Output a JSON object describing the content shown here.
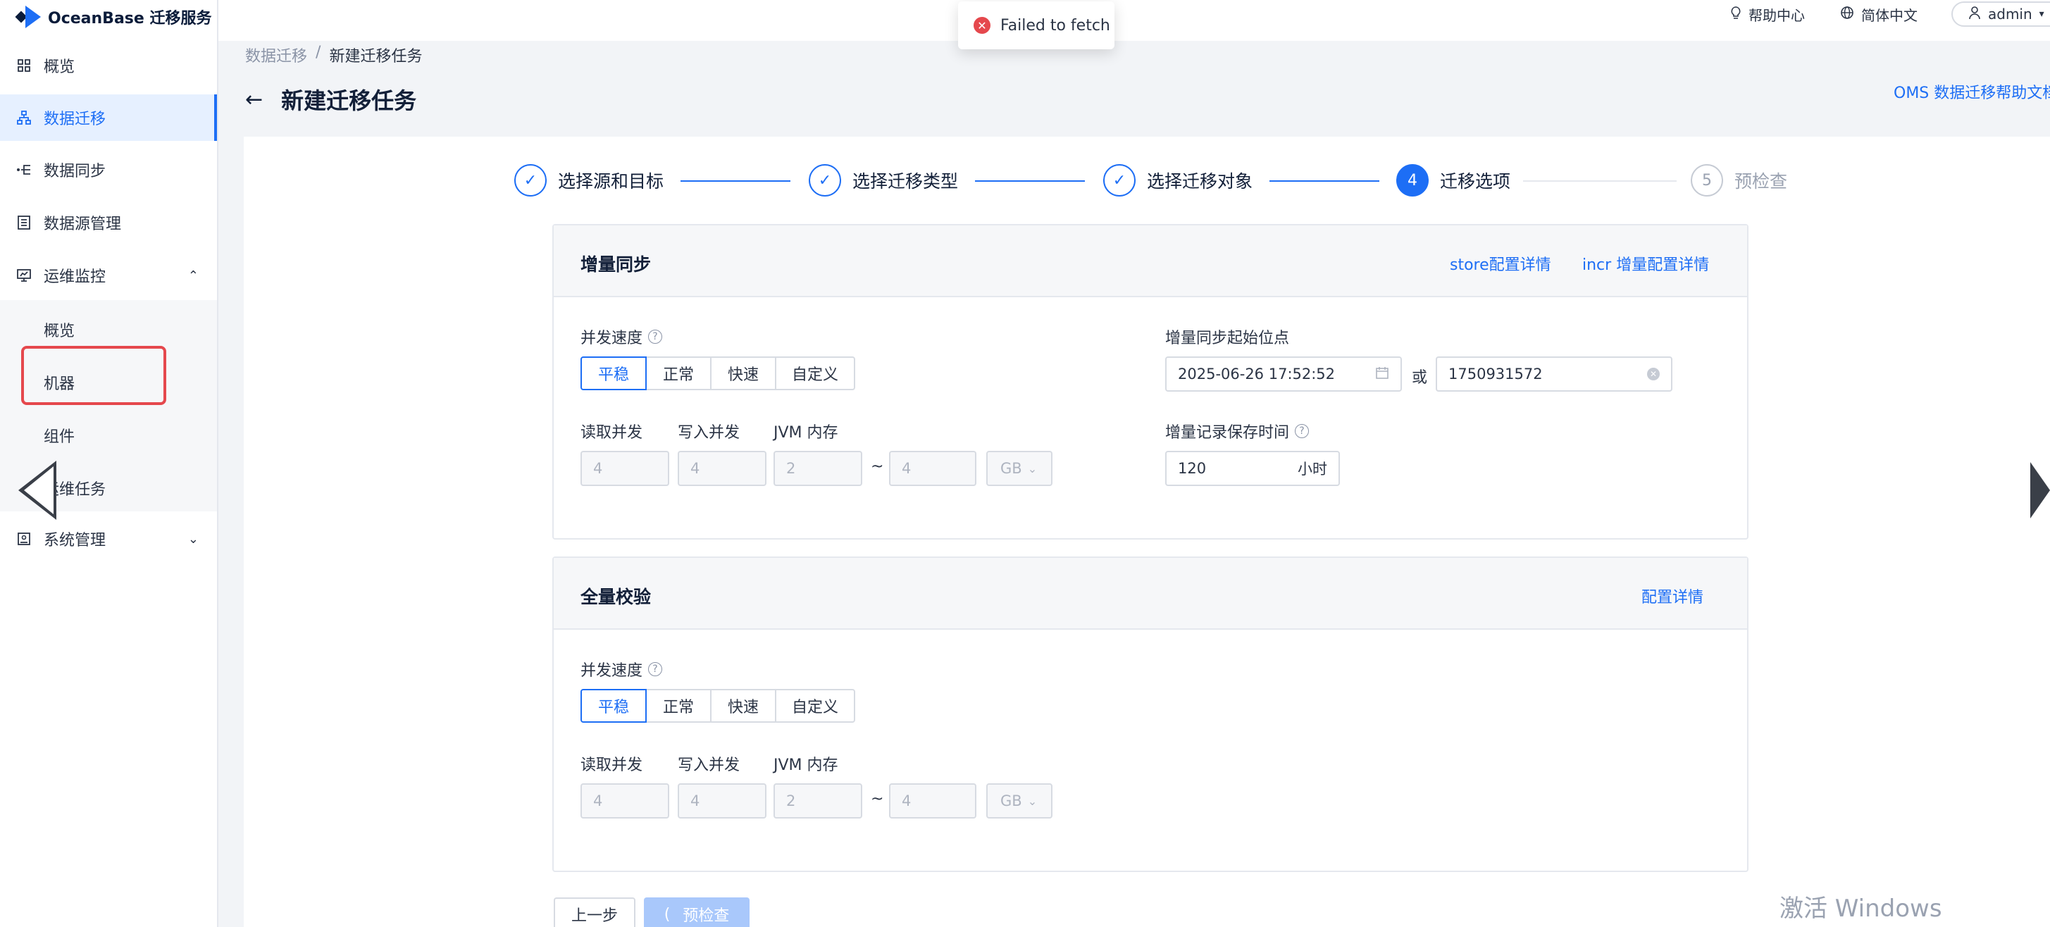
{
  "app": {
    "logo_text": "OceanBase 迁移服务"
  },
  "header": {
    "help": "帮助中心",
    "language": "简体中文",
    "user": "admin"
  },
  "toast": {
    "message": "Failed to fetch"
  },
  "sidebar": {
    "items": [
      {
        "label": "概览",
        "icon": "dashboard-icon"
      },
      {
        "label": "数据迁移",
        "icon": "migration-icon"
      },
      {
        "label": "数据同步",
        "icon": "sync-icon"
      },
      {
        "label": "数据源管理",
        "icon": "datasource-icon"
      },
      {
        "label": "运维监控",
        "icon": "monitor-icon"
      },
      {
        "label": "系统管理",
        "icon": "system-icon"
      }
    ],
    "monitor_sub": [
      "概览",
      "机器",
      "组件",
      "运维任务"
    ]
  },
  "breadcrumb": {
    "parent": "数据迁移",
    "separator": "/",
    "current": "新建迁移任务"
  },
  "page": {
    "title": "新建迁移任务",
    "help_link": "OMS 数据迁移帮助文档"
  },
  "steps": [
    {
      "label": "选择源和目标",
      "status": "done"
    },
    {
      "label": "选择迁移类型",
      "status": "done"
    },
    {
      "label": "选择迁移对象",
      "status": "done"
    },
    {
      "label": "迁移选项",
      "status": "current",
      "index": "4"
    },
    {
      "label": "预检查",
      "status": "wait",
      "index": "5"
    }
  ],
  "incr": {
    "title": "增量同步",
    "link_store": "store配置详情",
    "link_incr": "incr 增量配置详情",
    "concurrency_label": "并发速度",
    "speed_options": [
      "平稳",
      "正常",
      "快速",
      "自定义"
    ],
    "selected_speed": "平稳",
    "read_label": "读取并发",
    "write_label": "写入并发",
    "jvm_label": "JVM 内存",
    "read_value": "4",
    "write_value": "4",
    "jvm_min": "2",
    "jvm_max": "4",
    "jvm_unit": "GB",
    "start_label": "增量同步起始位点",
    "start_datetime": "2025-06-26 17:52:52",
    "or_text": "或",
    "start_timestamp": "1750931572",
    "retention_label": "增量记录保存时间",
    "retention_value": "120",
    "retention_unit": "小时"
  },
  "full": {
    "title": "全量校验",
    "link": "配置详情",
    "concurrency_label": "并发速度",
    "speed_options": [
      "平稳",
      "正常",
      "快速",
      "自定义"
    ],
    "selected_speed": "平稳",
    "read_label": "读取并发",
    "write_label": "写入并发",
    "jvm_label": "JVM 内存",
    "read_value": "4",
    "write_value": "4",
    "jvm_min": "2",
    "jvm_max": "4",
    "jvm_unit": "GB"
  },
  "footer": {
    "prev": "上一步",
    "next": "预检查"
  },
  "watermark": "激活 Windows",
  "colors": {
    "primary": "#1d6ef5",
    "error": "#e5484d",
    "highlight": "#e5484d"
  }
}
